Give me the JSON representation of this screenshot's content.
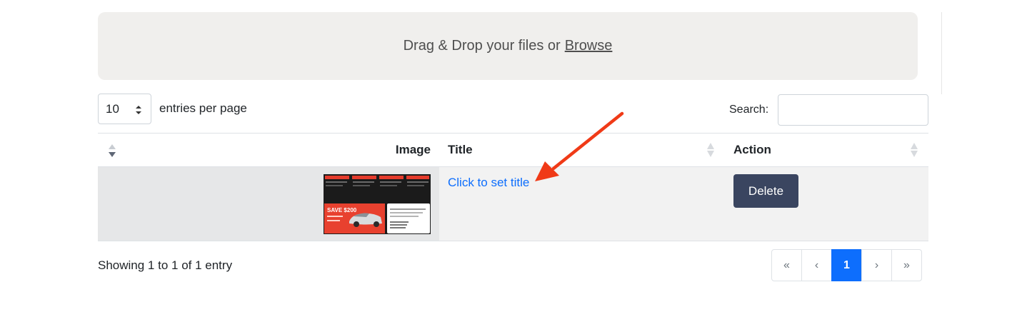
{
  "dropzone": {
    "text": "Drag & Drop your files or",
    "browse_label": "Browse"
  },
  "entries": {
    "selected": "10",
    "label": "entries per page"
  },
  "search": {
    "label": "Search:",
    "value": "",
    "placeholder": ""
  },
  "table": {
    "columns": {
      "image": "Image",
      "title": "Title",
      "action": "Action"
    },
    "rows": [
      {
        "image_alt": "Car promotion postcard thumbnail",
        "thumb_text": "SAVE $200",
        "title_link": "Click to set title",
        "action_label": "Delete"
      }
    ]
  },
  "footer": {
    "showing": "Showing 1 to 1 of 1 entry"
  },
  "pagination": {
    "first": "«",
    "prev": "‹",
    "current": "1",
    "next": "›",
    "last": "»"
  },
  "colors": {
    "link": "#0d6efd",
    "primary": "#0d6efd",
    "delete_button": "#3a4560",
    "annotation_arrow": "#f03a17"
  },
  "icons": [
    "sort-icon",
    "select-arrows-icon",
    "annotation-arrow-icon"
  ]
}
